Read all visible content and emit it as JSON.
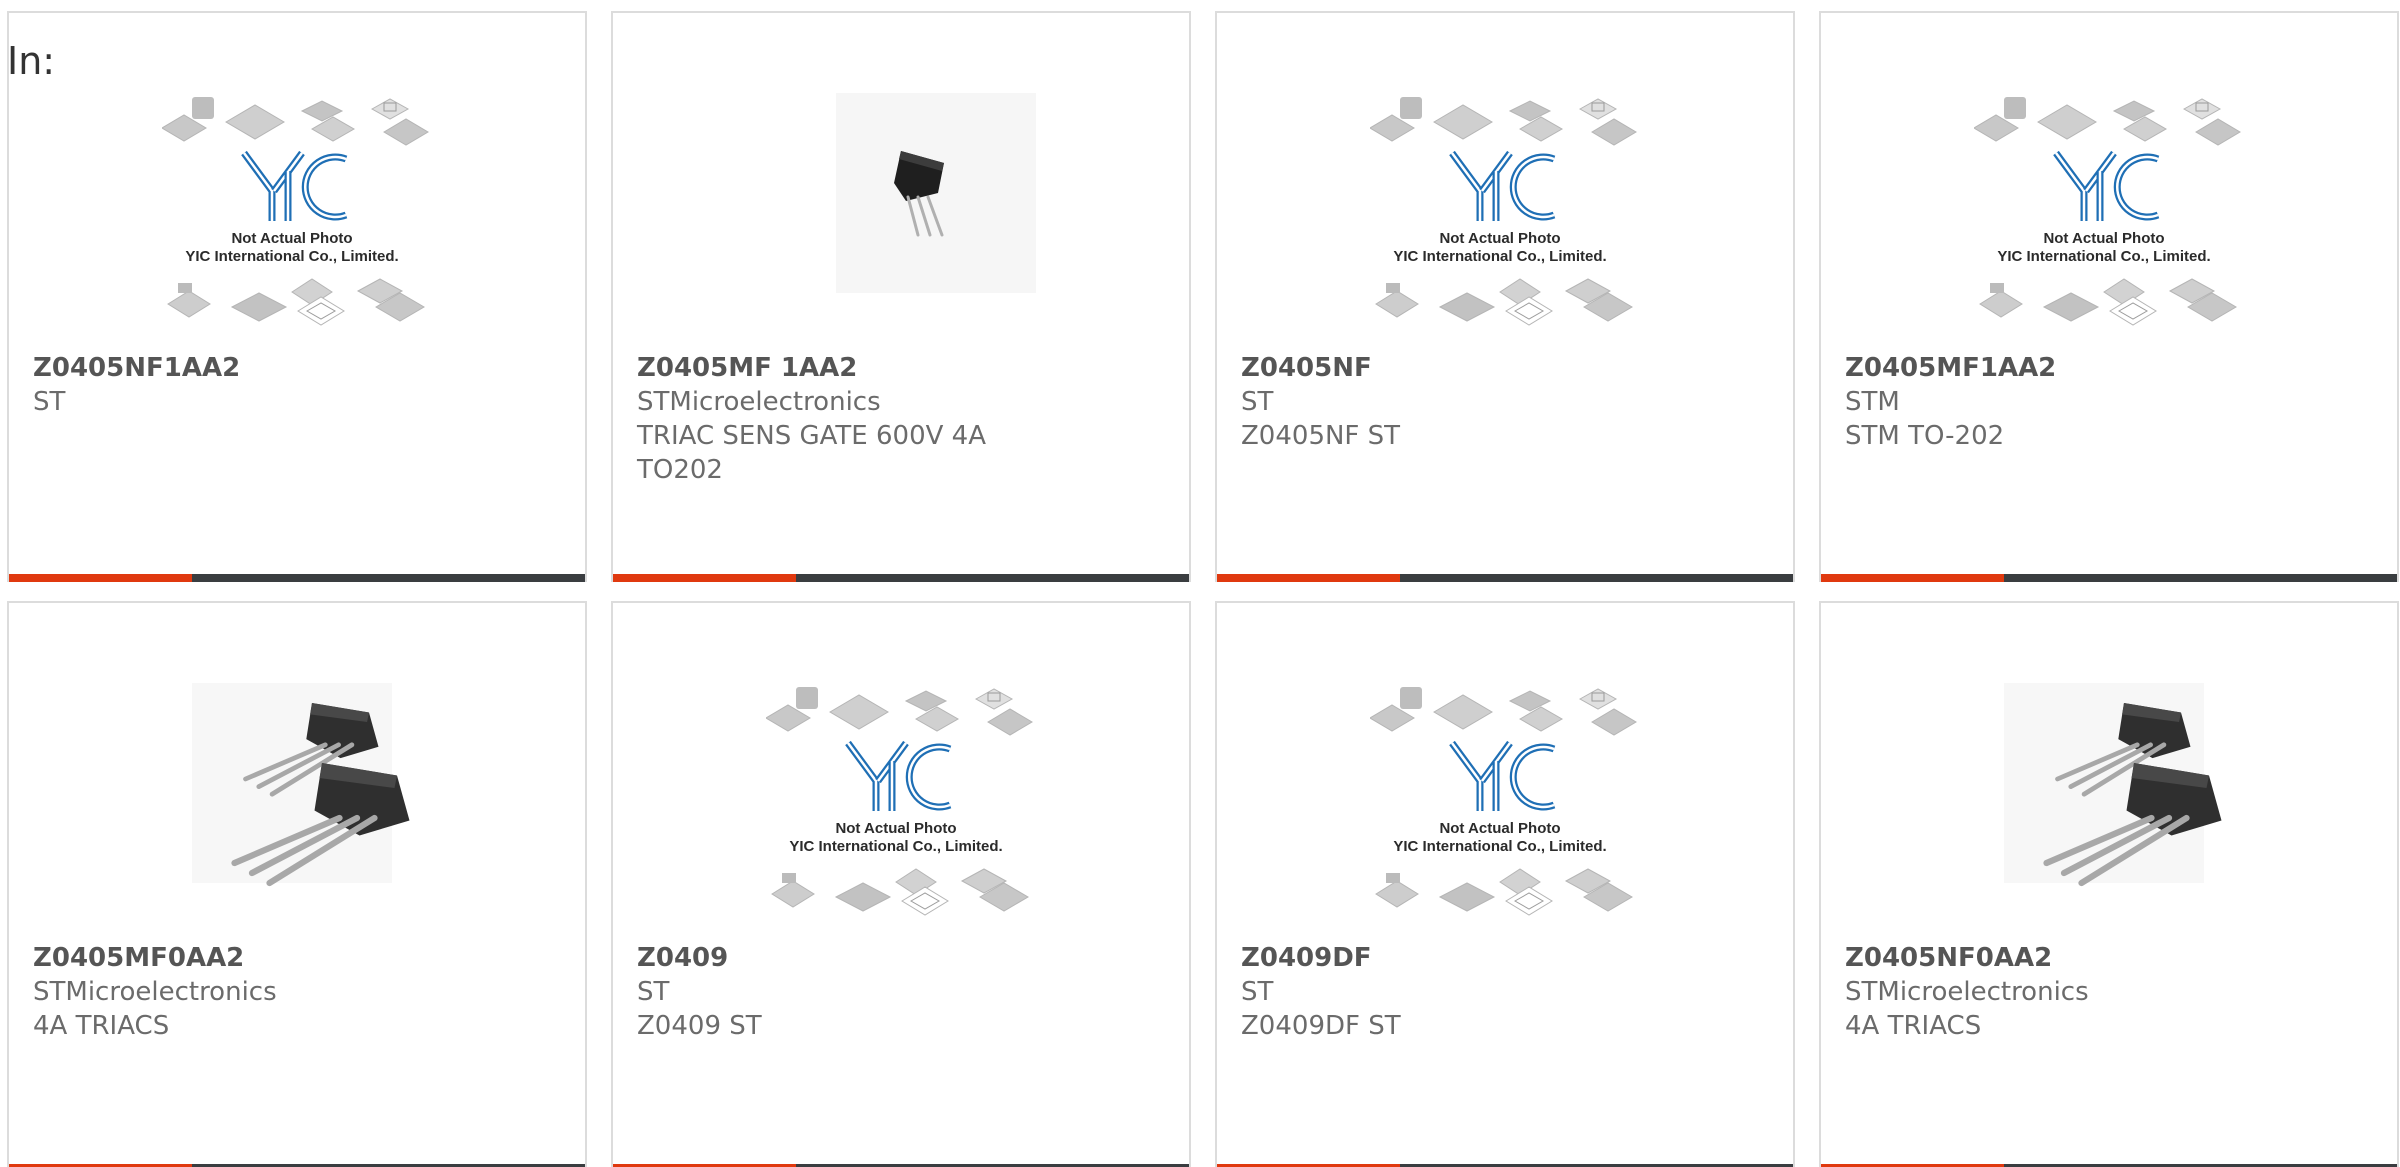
{
  "header": {
    "in_label": "In:"
  },
  "placeholder": {
    "brand": "YIC",
    "line1": "Not Actual Photo",
    "line2": "YIC International Co., Limited."
  },
  "colors": {
    "accent": "#e0390f",
    "bar": "#3a3d40",
    "logo_blue": "#1f6fb5"
  },
  "products": [
    {
      "part": "Z0405NF1AA2",
      "manufacturer": "ST",
      "description": "",
      "image": "placeholder-logo"
    },
    {
      "part": "Z0405MF 1AA2",
      "manufacturer": "STMicroelectronics",
      "description": "TRIAC SENS GATE 600V 4A TO202",
      "image": "to202-single"
    },
    {
      "part": "Z0405NF",
      "manufacturer": "ST",
      "description": "Z0405NF ST",
      "image": "placeholder-logo"
    },
    {
      "part": "Z0405MF1AA2",
      "manufacturer": "STM",
      "description": "STM TO-202",
      "image": "placeholder-logo"
    },
    {
      "part": "Z0405MF0AA2",
      "manufacturer": "STMicroelectronics",
      "description": "4A TRIACS",
      "image": "to202-pair"
    },
    {
      "part": "Z0409",
      "manufacturer": "ST",
      "description": "Z0409 ST",
      "image": "placeholder-logo"
    },
    {
      "part": "Z0409DF",
      "manufacturer": "ST",
      "description": "Z0409DF ST",
      "image": "placeholder-logo"
    },
    {
      "part": "Z0405NF0AA2",
      "manufacturer": "STMicroelectronics",
      "description": "4A TRIACS",
      "image": "to202-pair"
    }
  ]
}
